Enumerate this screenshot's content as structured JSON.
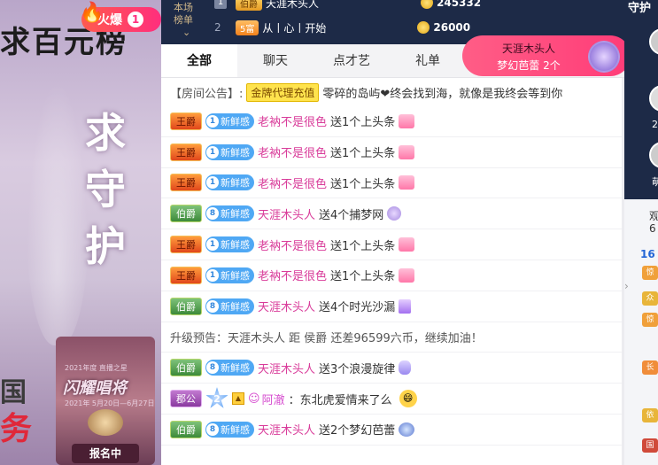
{
  "left_promo": {
    "title": "求百元榜",
    "hot_label": "火爆",
    "hot_rank": "1",
    "vertical_text": [
      "求",
      "守",
      "护"
    ],
    "mid_text": "国",
    "bottom_text": "务",
    "event": {
      "subtitle": "2021年度 直播之星",
      "title": "闪耀唱将",
      "date": "2021年 5月20日—6月27日",
      "signup_label": "报名中"
    }
  },
  "rank": {
    "label_lines": [
      "本场",
      "榜单"
    ],
    "rows": [
      {
        "index": "1",
        "badge": "伯爵",
        "name": "天涯木头人",
        "coins": "245332"
      },
      {
        "index": "2",
        "badge": "5富",
        "name": "从丨心丨开始",
        "coins": "26000"
      }
    ]
  },
  "tabs": [
    "全部",
    "聊天",
    "点才艺",
    "礼单"
  ],
  "gift_popup": {
    "sender": "天涯木头人",
    "gift_text": "梦幻芭蕾 2个"
  },
  "announcement": {
    "label": "【房间公告】:",
    "tag": "金牌代理充值",
    "text": "零碎的岛屿❤终会找到海，就像是我终会等到你"
  },
  "messages": [
    {
      "noble": "王爵",
      "noble_type": "wang",
      "level": "1",
      "fan": "新鲜感",
      "user": "老衲不是很色",
      "action": "送1个上头条",
      "gift": "上头条",
      "gift_type": "default"
    },
    {
      "noble": "王爵",
      "noble_type": "wang",
      "level": "1",
      "fan": "新鲜感",
      "user": "老衲不是很色",
      "action": "送1个上头条",
      "gift": "上头条",
      "gift_type": "default"
    },
    {
      "noble": "王爵",
      "noble_type": "wang",
      "level": "1",
      "fan": "新鲜感",
      "user": "老衲不是很色",
      "action": "送1个上头条",
      "gift": "上头条",
      "gift_type": "default"
    },
    {
      "noble": "伯爵",
      "noble_type": "bo",
      "level": "8",
      "fan": "新鲜感",
      "user": "天涯木头人",
      "action": "送4个捕梦网",
      "gift": "捕梦网",
      "gift_type": "net"
    },
    {
      "noble": "王爵",
      "noble_type": "wang",
      "level": "1",
      "fan": "新鲜感",
      "user": "老衲不是很色",
      "action": "送1个上头条",
      "gift": "上头条",
      "gift_type": "default"
    },
    {
      "noble": "王爵",
      "noble_type": "wang",
      "level": "1",
      "fan": "新鲜感",
      "user": "老衲不是很色",
      "action": "送1个上头条",
      "gift": "上头条",
      "gift_type": "default"
    },
    {
      "noble": "伯爵",
      "noble_type": "bo",
      "level": "8",
      "fan": "新鲜感",
      "user": "天涯木头人",
      "action": "送4个时光沙漏",
      "gift": "时光沙漏",
      "gift_type": "hourglass"
    }
  ],
  "levelup_text": "升级预告：天涯木头人 距 侯爵 还差96599六币，继续加油！",
  "messages2": [
    {
      "noble": "伯爵",
      "noble_type": "bo",
      "level": "8",
      "fan": "新鲜感",
      "user": "天涯木头人",
      "action": "送3个浪漫旋律",
      "gift": "浪漫旋律",
      "gift_type": "wave"
    }
  ],
  "chat_message": {
    "noble": "郡公",
    "star_level": "2",
    "user": "阿澈",
    "text": "：东北虎爱情来了么"
  },
  "messages3": [
    {
      "noble": "伯爵",
      "noble_type": "bo",
      "level": "8",
      "fan": "新鲜感",
      "user": "天涯木头人",
      "action": "送2个梦幻芭蕾",
      "gift": "梦幻芭蕾",
      "gift_type": "dream"
    }
  ],
  "right_panel": {
    "title": "守护",
    "num1": "2",
    "name_fragment": "萌",
    "label1": "观",
    "label2": "6",
    "count": "16",
    "tags": [
      "惊",
      "众",
      "惊",
      "长",
      "依",
      "国"
    ]
  }
}
